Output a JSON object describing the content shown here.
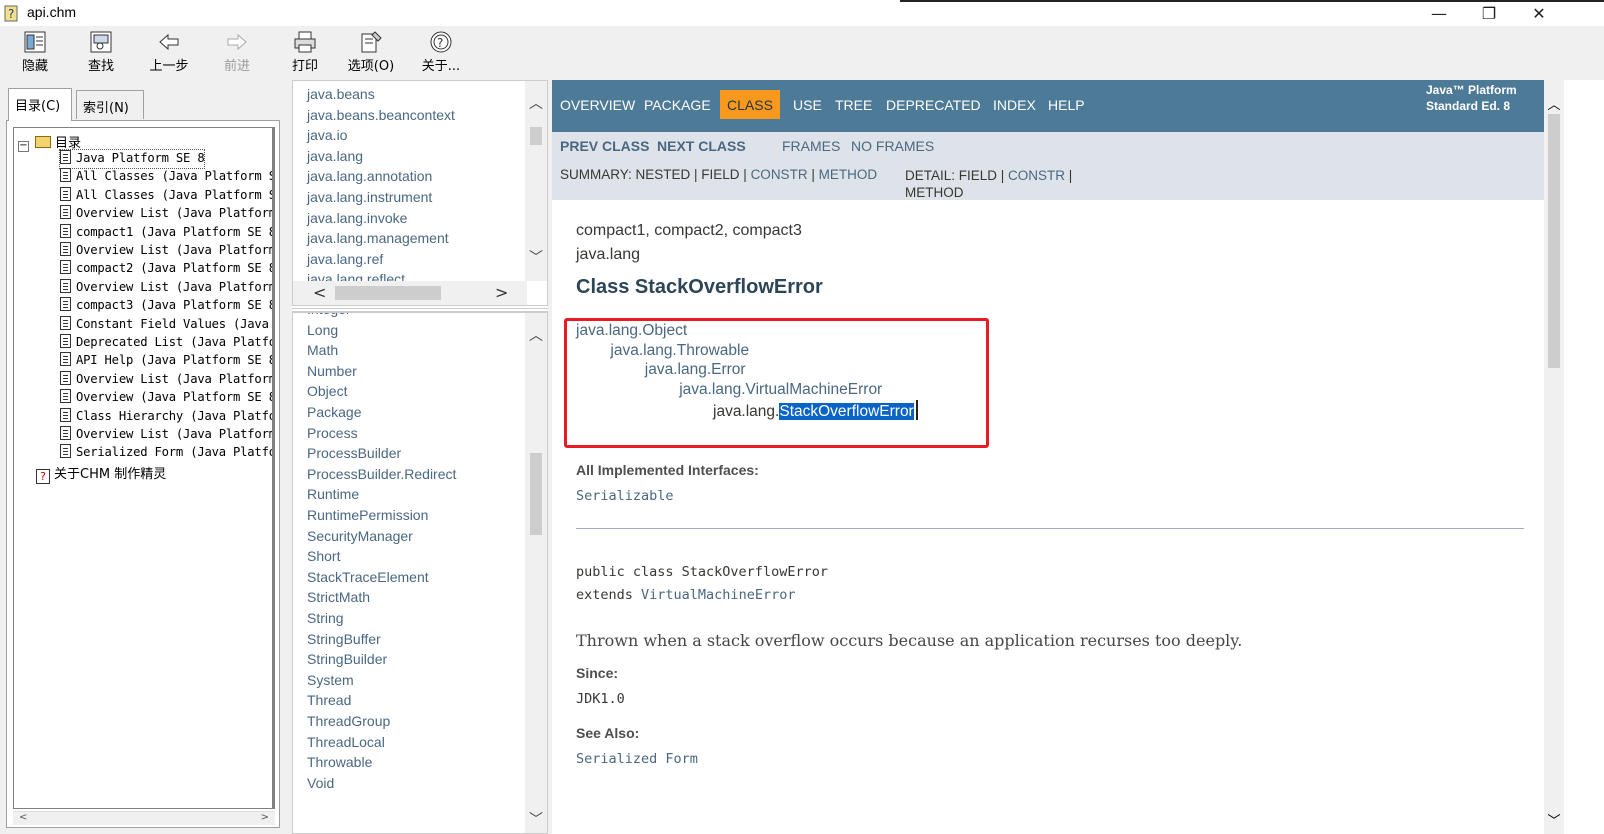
{
  "window": {
    "title": "api.chm",
    "minimize": "—",
    "restore": "❐",
    "close": "✕"
  },
  "toolbar": {
    "hide": "隐藏",
    "find": "查找",
    "back": "上一步",
    "forward": "前进",
    "print": "打印",
    "options": "选项(O)",
    "about": "关于..."
  },
  "left_tabs": {
    "contents": "目录(C)",
    "index": "索引(N)"
  },
  "tree": {
    "root": "目录",
    "items": [
      "Java Platform SE 8",
      "All Classes (Java Platform S",
      "All Classes (Java Platform S",
      "Overview List (Java Platform",
      "compact1 (Java Platform SE 8",
      "Overview List (Java Platform",
      "compact2 (Java Platform SE 8",
      "Overview List (Java Platform",
      "compact3 (Java Platform SE 8",
      "Constant Field Values (Java",
      "Deprecated List (Java Platfo",
      "API Help (Java Platform SE 8",
      "Overview List (Java Platform",
      "Overview (Java Platform SE 8",
      "Class Hierarchy (Java Platfo",
      "Overview List (Java Platform",
      "Serialized Form (Java Platfo"
    ],
    "about": "关于CHM 制作精灵"
  },
  "packages": [
    "java.beans",
    "java.beans.beancontext",
    "java.io",
    "java.lang",
    "java.lang.annotation",
    "java.lang.instrument",
    "java.lang.invoke",
    "java.lang.management",
    "java.lang.ref",
    "java.lang.reflect"
  ],
  "classes": [
    "Integer",
    "Long",
    "Math",
    "Number",
    "Object",
    "Package",
    "Process",
    "ProcessBuilder",
    "ProcessBuilder.Redirect",
    "Runtime",
    "RuntimePermission",
    "SecurityManager",
    "Short",
    "StackTraceElement",
    "StrictMath",
    "String",
    "StringBuffer",
    "StringBuilder",
    "System",
    "Thread",
    "ThreadGroup",
    "ThreadLocal",
    "Throwable",
    "Void"
  ],
  "nav": {
    "overview": "OVERVIEW",
    "package": "PACKAGE",
    "class": "CLASS",
    "use": "USE",
    "tree": "TREE",
    "deprecated": "DEPRECATED",
    "index": "INDEX",
    "help": "HELP",
    "platform_1": "Java™ Platform",
    "platform_2": "Standard Ed. 8"
  },
  "subnav": {
    "prev": "PREV CLASS",
    "next": "NEXT CLASS",
    "frames": "FRAMES",
    "noframes": "NO FRAMES",
    "summary_label": "SUMMARY: NESTED | FIELD | ",
    "summary_constr": "CONSTR",
    "summary_sep": " | ",
    "summary_method": "METHOD",
    "detail_label": "DETAIL: FIELD | ",
    "detail_constr": "CONSTR",
    "detail_sep": " |",
    "detail_method": "METHOD"
  },
  "doc": {
    "profiles": "compact1, compact2, compact3",
    "package": "java.lang",
    "heading": "Class StackOverflowError",
    "hierarchy": [
      "java.lang.Object",
      "java.lang.Throwable",
      "java.lang.Error",
      "java.lang.VirtualMachineError"
    ],
    "hier_last_prefix": "java.lang.",
    "hier_last_selected": "StackOverflowError",
    "interfaces_label": "All Implemented Interfaces:",
    "interfaces_value": "Serializable",
    "decl_1": "public class StackOverflowError",
    "decl_2_kw": "extends ",
    "decl_2_link": "VirtualMachineError",
    "description": "Thrown when a stack overflow occurs because an application recurses too deeply.",
    "since_label": "Since:",
    "since_value": "JDK1.0",
    "see_also_label": "See Also:",
    "see_also_value": "Serialized Form"
  }
}
